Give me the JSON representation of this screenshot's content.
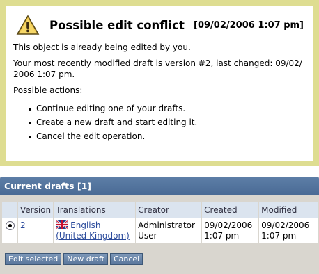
{
  "warning": {
    "title": "Possible edit conflict",
    "timestamp": "[09/02/2006 1:07 pm]",
    "line1": "This object is already being edited by you.",
    "line2": "Your most recently modified draft is version #2, last changed: 09/02/ 2006 1:07 pm.",
    "actions_heading": "Possible actions:",
    "actions": [
      "Continue editing one of your drafts.",
      "Create a new draft and start editing it.",
      "Cancel the edit operation."
    ],
    "icon": "warning-triangle-icon"
  },
  "drafts": {
    "heading": "Current drafts [1]",
    "columns": [
      "Version",
      "Translations",
      "Creator",
      "Created",
      "Modified"
    ],
    "rows": [
      {
        "selected": true,
        "version": "2",
        "translation": "English (United Kingdom)",
        "flag": "uk-flag-icon",
        "creator": "Administrator User",
        "created": "09/02/2006 1:07 pm",
        "modified": "09/02/2006 1:07 pm"
      }
    ]
  },
  "buttons": {
    "edit_selected": "Edit selected",
    "new_draft": "New draft",
    "cancel": "Cancel"
  },
  "colors": {
    "warning_border": "#dedd91",
    "header_blue": "#4f709a",
    "column_header": "#dbe4ef",
    "link": "#2a4a9b"
  }
}
